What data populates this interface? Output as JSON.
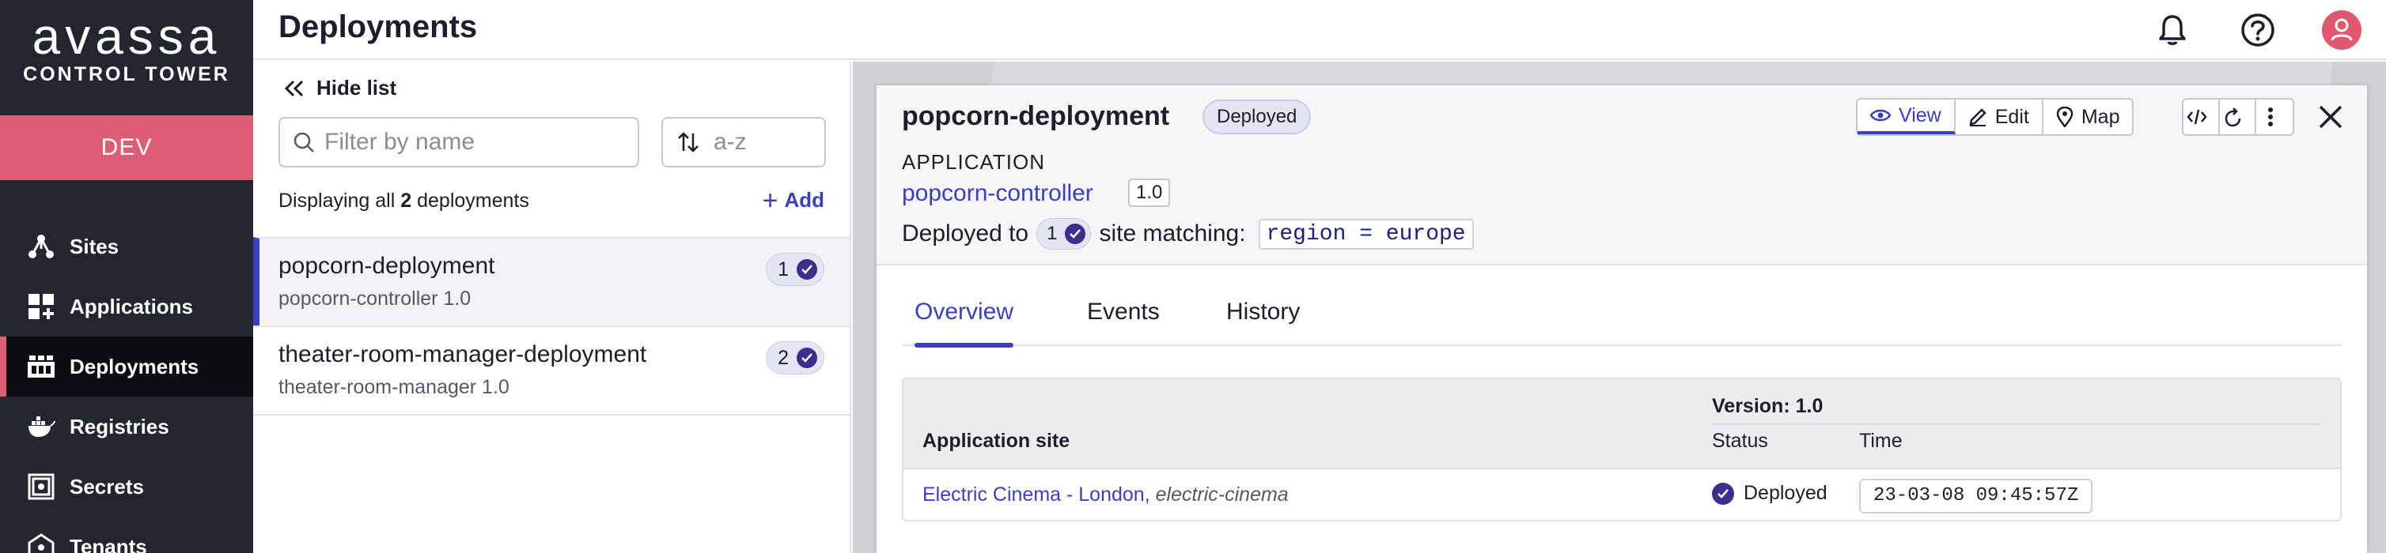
{
  "brand": {
    "wordmark": "avassa",
    "tagline": "CONTROL TOWER"
  },
  "environment": "DEV",
  "sidebar": {
    "items": [
      {
        "label": "Sites",
        "icon": "sites-icon"
      },
      {
        "label": "Applications",
        "icon": "applications-icon"
      },
      {
        "label": "Deployments",
        "icon": "deployments-icon",
        "active": true
      },
      {
        "label": "Registries",
        "icon": "registries-icon"
      },
      {
        "label": "Secrets",
        "icon": "secrets-icon"
      },
      {
        "label": "Tenants",
        "icon": "tenants-icon"
      }
    ]
  },
  "header": {
    "title": "Deployments",
    "icons": [
      "bell-icon",
      "help-icon",
      "user-avatar-icon"
    ]
  },
  "list": {
    "hide_label": "Hide list",
    "filter_placeholder": "Filter by name",
    "sort_label": "a-z",
    "count_prefix": "Displaying all",
    "count": "2",
    "count_suffix": "deployments",
    "add_label": "Add",
    "rows": [
      {
        "name": "popcorn-deployment",
        "app": "popcorn-controller 1.0",
        "sites": "1",
        "selected": true
      },
      {
        "name": "theater-room-manager-deployment",
        "app": "theater-room-manager 1.0",
        "sites": "2"
      }
    ]
  },
  "detail": {
    "title": "popcorn-deployment",
    "status": "Deployed",
    "buttons": {
      "view": "View",
      "edit": "Edit",
      "map": "Map"
    },
    "application_label": "APPLICATION",
    "application_name": "popcorn-controller",
    "application_version": "1.0",
    "deployed_to_prefix": "Deployed to",
    "deployed_count": "1",
    "deployed_to_suffix": "site matching:",
    "match_expr": "region = europe",
    "tabs": [
      "Overview",
      "Events",
      "History"
    ],
    "active_tab": "Overview",
    "table": {
      "version_header": "Version: 1.0",
      "col_site": "Application site",
      "col_status": "Status",
      "col_time": "Time",
      "rows": [
        {
          "site_name": "Electric Cinema - London",
          "site_id": "electric-cinema",
          "status": "Deployed",
          "time": "23-03-08 09:45:57Z"
        }
      ]
    }
  },
  "colors": {
    "accent": "#3a3fc0",
    "env": "#dd5d74",
    "sidebar": "#23262f",
    "check": "#3b2f8c"
  }
}
